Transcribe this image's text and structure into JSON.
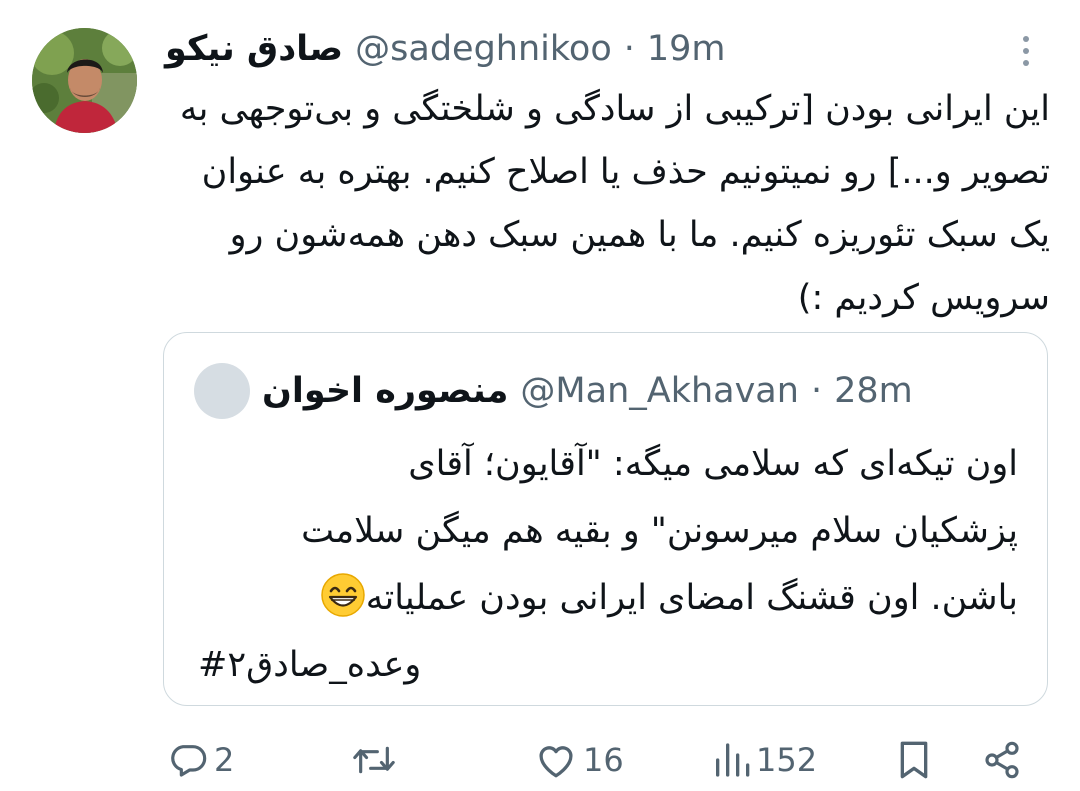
{
  "tweet": {
    "author_name": "صادق نیکو",
    "author_handle": "@sadeghnikoo",
    "separator": "·",
    "time": "19m",
    "body": "این ایرانی بودن [ترکیبی از سادگی و شلختگی و بی‌توجهی به تصویر و...] رو نمیتونیم حذف یا اصلاح کنیم. بهتره به عنوان یک سبک تئوریزه کنیم. ما با همین سبک دهن همه‌شون رو سرویس کردیم :)"
  },
  "quote": {
    "author_name": "منصوره اخوان",
    "author_handle": "@Man_Akhavan",
    "separator": "·",
    "time": "28m",
    "lines": [
      "اون تیکه‌ای که سلامی میگه: \"آقایون؛ آقای",
      "پزشکیان سلام میرسونن\" و بقیه هم میگن سلامت",
      "باشن. اون قشنگ امضای ایرانی بودن عملیاته"
    ],
    "hashtag": "#وعده_صادق۲",
    "emoji": "grinning-face-with-smiling-eyes"
  },
  "actions": {
    "reply_count": "2",
    "retweet_count": "",
    "like_count": "16",
    "views_count": "152"
  },
  "icons": {
    "more": "more-vertical-icon",
    "reply": "reply-icon",
    "retweet": "retweet-icon",
    "like": "heart-icon",
    "views": "views-icon",
    "bookmark": "bookmark-icon",
    "share": "share-icon"
  },
  "colors": {
    "text_primary": "#0f1419",
    "text_secondary": "#536471",
    "border": "#cfd9de"
  }
}
